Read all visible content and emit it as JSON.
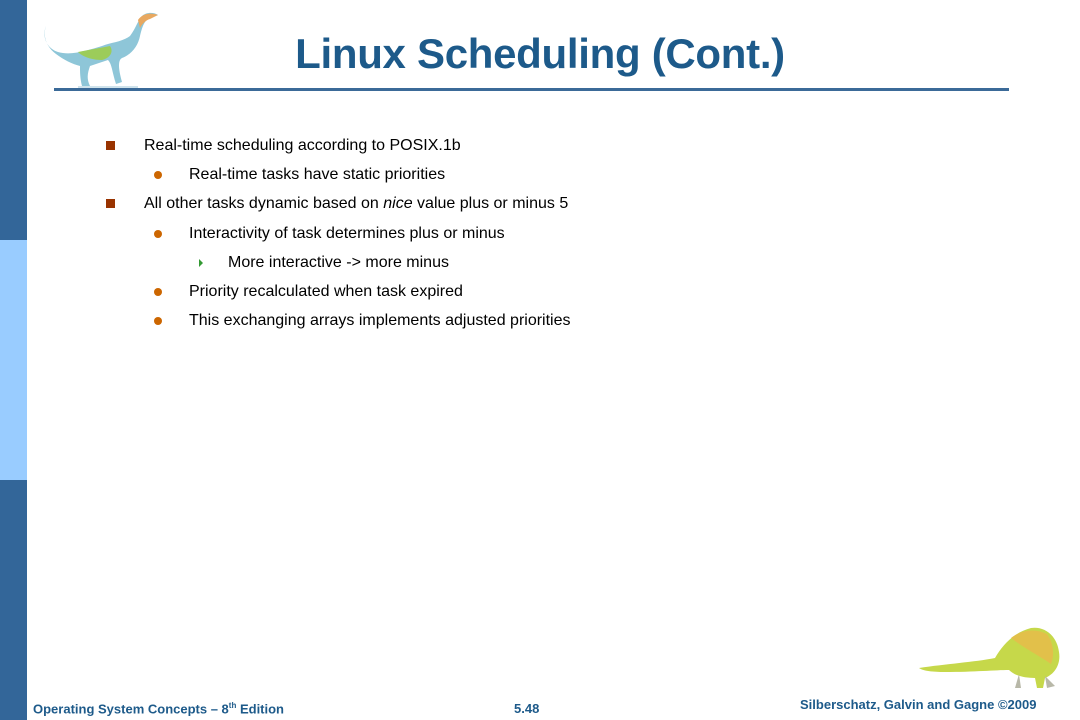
{
  "slide": {
    "title": "Linux Scheduling (Cont.)",
    "bullets": [
      {
        "level": 1,
        "text": "Real-time scheduling according to POSIX.1b"
      },
      {
        "level": 2,
        "text": "Real-time tasks have static priorities"
      },
      {
        "level": 1,
        "text_before": "All other tasks dynamic based on ",
        "text_italic": "nice",
        "text_after": " value plus or minus 5"
      },
      {
        "level": 2,
        "text": "Interactivity of task determines plus or minus"
      },
      {
        "level": 3,
        "text": "More interactive -> more minus"
      },
      {
        "level": 2,
        "text": "Priority recalculated when task expired"
      },
      {
        "level": 2,
        "text": "This exchanging arrays implements adjusted priorities"
      }
    ]
  },
  "footer": {
    "book_prefix": "Operating System Concepts – 8",
    "book_sup": "th",
    "book_suffix": " Edition",
    "page_number": "5.48",
    "copyright": "Silberschatz, Galvin and Gagne ©2009"
  },
  "colors": {
    "sidebar_dark": "#336699",
    "sidebar_light": "#99ccff",
    "title": "#1d5a8a",
    "bullet_level1": "#993300",
    "bullet_level2": "#cc6600",
    "bullet_level3": "#339933"
  }
}
